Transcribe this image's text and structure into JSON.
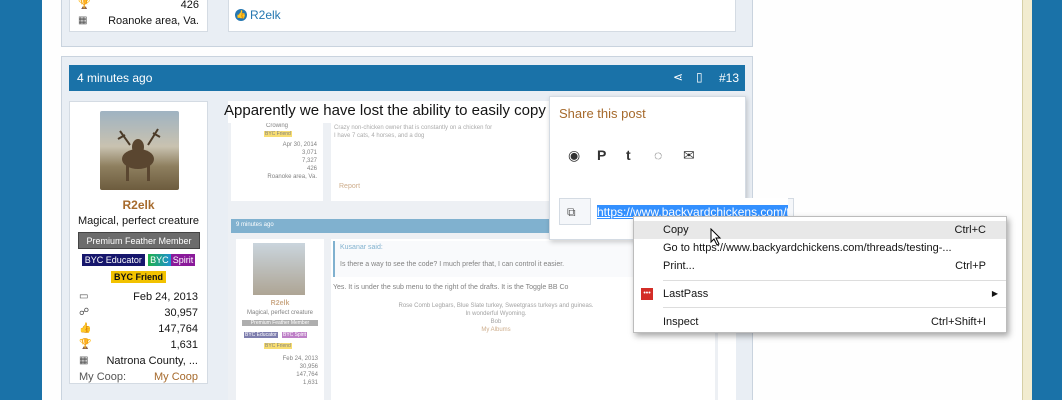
{
  "prev_post": {
    "stat_value_top": "426",
    "location_label": "Roanoke area, Va.",
    "reaction_user": "R2elk"
  },
  "post": {
    "time": "4 minutes ago",
    "number": "#13",
    "body_text": "Apparently we have lost the ability to easily copy a sp",
    "user": {
      "name": "R2elk",
      "title": "Magical, perfect creature",
      "member_badge": "Premium Feather Member",
      "badge_educator": "BYC Educator",
      "badge_spirit_byc": "BYC",
      "badge_spirit": "Spirit",
      "badge_friend": "BYC Friend",
      "joined": "Feb 24, 2013",
      "messages": "30,957",
      "reactions": "147,764",
      "points": "1,631",
      "location": "Natrona County, ...",
      "coop_label": "My Coop:",
      "coop_link": "My Coop"
    }
  },
  "screenshot_img": {
    "rank": "Crowing",
    "friend": "BYC Friend",
    "date": "Apr 30, 2014",
    "v1": "3,071",
    "v2": "7,327",
    "v3": "426",
    "loc": "Roanoke area, Va.",
    "sig1": "Crazy non-chicken owner that is constantly on a chicken for",
    "sig2": "I have 7 cats, 4 horses, and a dog",
    "report": "Report",
    "inner_time": "9 minutes ago",
    "inner_name": "R2elk",
    "inner_title": "Magical, perfect creature",
    "inner_member": "Premium Feather Member",
    "inner_edu": "BYC Educator",
    "inner_spirit": "BYC Spirit",
    "inner_friend": "BYC Friend",
    "inner_date": "Feb 24, 2013",
    "inner_v1": "30,956",
    "inner_v2": "147,764",
    "inner_v3": "1,631",
    "quote_author": "Kusanar said:",
    "quote_text": "Is there a way to see the code? I much prefer that, I can control it easier.",
    "reply_text": "Yes. It is under the sub menu to the right of the drafts. It is the Toggle BB Co",
    "sig_line1": "Rose Comb Legbars, Blue Slate turkey, Sweetgrass turkeys and guineas.",
    "sig_line2": "In wonderful Wyoming.",
    "sig_line3": "Bob",
    "sig_line4": "My Albums"
  },
  "share_popup": {
    "title": "Share this post",
    "url": "https://www.backyardchickens.com/th"
  },
  "context_menu": {
    "copy": "Copy",
    "copy_sc": "Ctrl+C",
    "goto": "Go to https://www.backyardchickens.com/threads/testing-...",
    "print": "Print...",
    "print_sc": "Ctrl+P",
    "lastpass": "LastPass",
    "inspect": "Inspect",
    "inspect_sc": "Ctrl+Shift+I"
  },
  "colors": {
    "accent": "#1a72a8",
    "link": "#a66a2c",
    "selection": "#3390ff"
  }
}
